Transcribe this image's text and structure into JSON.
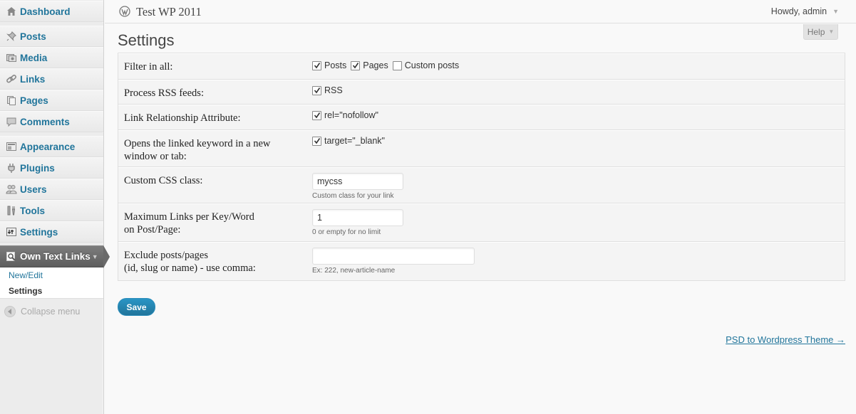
{
  "site": {
    "title": "Test WP 2011",
    "howdy": "Howdy, admin",
    "help": "Help"
  },
  "sidebar": {
    "items": [
      {
        "label": "Dashboard",
        "icon": "dashboard-icon"
      },
      {
        "label": "Posts",
        "icon": "pushpin-icon"
      },
      {
        "label": "Media",
        "icon": "media-icon"
      },
      {
        "label": "Links",
        "icon": "chain-link-icon"
      },
      {
        "label": "Pages",
        "icon": "pages-icon"
      },
      {
        "label": "Comments",
        "icon": "speech-bubble-icon"
      },
      {
        "label": "Appearance",
        "icon": "appearance-icon"
      },
      {
        "label": "Plugins",
        "icon": "plug-icon"
      },
      {
        "label": "Users",
        "icon": "users-icon"
      },
      {
        "label": "Tools",
        "icon": "tools-icon"
      },
      {
        "label": "Settings",
        "icon": "settings-icon"
      },
      {
        "label": "Own Text Links",
        "icon": "magnifier-icon"
      }
    ],
    "submenu": [
      "New/Edit",
      "Settings"
    ],
    "collapse": "Collapse menu"
  },
  "page": {
    "title": "Settings"
  },
  "form": {
    "filter": {
      "label": "Filter in all:",
      "options": [
        {
          "label": "Posts",
          "checked": true
        },
        {
          "label": "Pages",
          "checked": true
        },
        {
          "label": "Custom posts",
          "checked": false
        }
      ]
    },
    "rss": {
      "label": "Process RSS feeds:",
      "option": "RSS",
      "checked": true
    },
    "rel": {
      "label": "Link Relationship Attribute:",
      "option": "rel=\"nofollow\"",
      "checked": true
    },
    "target": {
      "label_line1": "Opens the linked keyword in a new",
      "label_line2": "window or tab:",
      "option": "target=\"_blank\"",
      "checked": true
    },
    "css_class": {
      "label": "Custom CSS class:",
      "value": "mycss",
      "description": "Custom class for your link"
    },
    "max_links": {
      "label_line1": "Maximum Links per Key/Word",
      "label_line2": "on Post/Page:",
      "value": "1",
      "description": "0 or empty for no limit"
    },
    "exclude": {
      "label_line1": "Exclude posts/pages",
      "label_line2": "(id, slug or name) - use comma:",
      "value": "",
      "description": "Ex: 222, new-article-name"
    },
    "save_label": "Save"
  },
  "footer": {
    "link": "PSD to Wordpress Theme →"
  },
  "colors": {
    "link": "#21759b",
    "current_menu": "#6a6a6a",
    "button": "#21759b"
  }
}
